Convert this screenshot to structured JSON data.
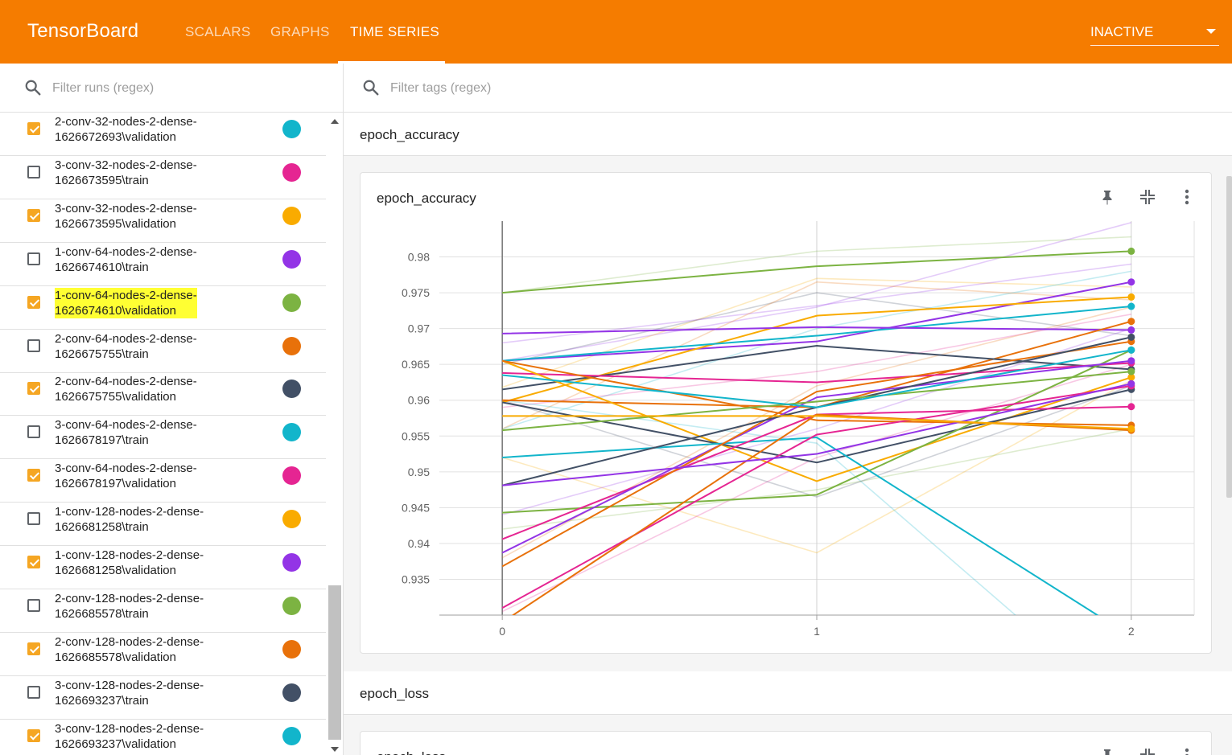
{
  "header": {
    "brand": "TensorBoard",
    "tabs": [
      {
        "label": "SCALARS",
        "active": false
      },
      {
        "label": "GRAPHS",
        "active": false
      },
      {
        "label": "TIME SERIES",
        "active": true
      }
    ],
    "run_state": "INACTIVE",
    "background_color": "#f57c00"
  },
  "sidebar": {
    "filter_placeholder": "Filter runs (regex)",
    "runs": [
      {
        "line1": "2-conv-32-nodes-2-dense-",
        "line2": "1626672693\\validation",
        "checked": true,
        "color": "#12b5cb",
        "highlighted": false
      },
      {
        "line1": "3-conv-32-nodes-2-dense-",
        "line2": "1626673595\\train",
        "checked": false,
        "color": "#e52592",
        "highlighted": false
      },
      {
        "line1": "3-conv-32-nodes-2-dense-",
        "line2": "1626673595\\validation",
        "checked": true,
        "color": "#f9ab00",
        "highlighted": false
      },
      {
        "line1": "1-conv-64-nodes-2-dense-",
        "line2": "1626674610\\train",
        "checked": false,
        "color": "#9334e6",
        "highlighted": false
      },
      {
        "line1": "1-conv-64-nodes-2-dense-",
        "line2": "1626674610\\validation",
        "checked": true,
        "color": "#7cb342",
        "highlighted": true
      },
      {
        "line1": "2-conv-64-nodes-2-dense-",
        "line2": "1626675755\\train",
        "checked": false,
        "color": "#e8710a",
        "highlighted": false
      },
      {
        "line1": "2-conv-64-nodes-2-dense-",
        "line2": "1626675755\\validation",
        "checked": true,
        "color": "#425066",
        "highlighted": false
      },
      {
        "line1": "3-conv-64-nodes-2-dense-",
        "line2": "1626678197\\train",
        "checked": false,
        "color": "#12b5cb",
        "highlighted": false
      },
      {
        "line1": "3-conv-64-nodes-2-dense-",
        "line2": "1626678197\\validation",
        "checked": true,
        "color": "#e52592",
        "highlighted": false
      },
      {
        "line1": "1-conv-128-nodes-2-dense-",
        "line2": "1626681258\\train",
        "checked": false,
        "color": "#f9ab00",
        "highlighted": false
      },
      {
        "line1": "1-conv-128-nodes-2-dense-",
        "line2": "1626681258\\validation",
        "checked": true,
        "color": "#9334e6",
        "highlighted": false
      },
      {
        "line1": "2-conv-128-nodes-2-dense-",
        "line2": "1626685578\\train",
        "checked": false,
        "color": "#7cb342",
        "highlighted": false
      },
      {
        "line1": "2-conv-128-nodes-2-dense-",
        "line2": "1626685578\\validation",
        "checked": true,
        "color": "#e8710a",
        "highlighted": false
      },
      {
        "line1": "3-conv-128-nodes-2-dense-",
        "line2": "1626693237\\train",
        "checked": false,
        "color": "#425066",
        "highlighted": false
      },
      {
        "line1": "3-conv-128-nodes-2-dense-",
        "line2": "1626693237\\validation",
        "checked": true,
        "color": "#12b5cb",
        "highlighted": false
      }
    ]
  },
  "main": {
    "tag_filter_placeholder": "Filter tags (regex)",
    "groups": [
      {
        "title": "epoch_accuracy",
        "card_title": "epoch_accuracy"
      },
      {
        "title": "epoch_loss",
        "card_title": "epoch_loss"
      }
    ]
  },
  "chart_data": {
    "type": "line",
    "title": "epoch_accuracy",
    "xlabel": "",
    "ylabel": "",
    "x": [
      0,
      1,
      2
    ],
    "xlim": [
      -0.2,
      2.2
    ],
    "ylim": [
      0.93,
      0.985
    ],
    "x_ticks": [
      "0",
      "1",
      "2"
    ],
    "y_ticks": [
      "0.935",
      "0.94",
      "0.945",
      "0.95",
      "0.955",
      "0.96",
      "0.965",
      "0.97",
      "0.975",
      "0.98"
    ],
    "grid": true,
    "series": [
      {
        "color": "#7cb342",
        "values": [
          0.975,
          0.9787,
          0.9808
        ]
      },
      {
        "color": "#9334e6",
        "values": [
          0.9655,
          0.9682,
          0.9765
        ]
      },
      {
        "color": "#f9ab00",
        "values": [
          0.9597,
          0.9718,
          0.9744
        ]
      },
      {
        "color": "#12b5cb",
        "values": [
          0.9655,
          0.969,
          0.9731
        ]
      },
      {
        "color": "#9334e6",
        "values": [
          0.9693,
          0.9702,
          0.9698
        ]
      },
      {
        "color": "#e8710a",
        "values": [
          0.96,
          0.959,
          0.971
        ]
      },
      {
        "color": "#425066",
        "values": [
          0.9615,
          0.9676,
          0.9643
        ]
      },
      {
        "color": "#e52592",
        "values": [
          0.9638,
          0.9625,
          0.9652
        ]
      },
      {
        "color": "#f9ab00",
        "values": [
          0.9655,
          0.9487,
          0.9632
        ]
      },
      {
        "color": "#425066",
        "values": [
          0.9597,
          0.9513,
          0.9615
        ]
      },
      {
        "color": "#7cb342",
        "values": [
          0.9443,
          0.9468,
          0.967
        ]
      },
      {
        "color": "#e8710a",
        "values": [
          0.9655,
          0.9572,
          0.9565
        ]
      },
      {
        "color": "#12b5cb",
        "values": [
          0.952,
          0.9548,
          0.927
        ]
      },
      {
        "color": "#e52592",
        "values": [
          0.9406,
          0.958,
          0.9591
        ]
      },
      {
        "color": "#9334e6",
        "values": [
          0.9387,
          0.9604,
          0.9655
        ]
      },
      {
        "color": "#e8710a",
        "values": [
          0.9368,
          0.9612,
          0.9682
        ]
      },
      {
        "color": "#e52592",
        "values": [
          0.931,
          0.9552,
          0.962
        ]
      },
      {
        "color": "#e8710a",
        "values": [
          0.929,
          0.958,
          0.9558
        ]
      },
      {
        "color": "#425066",
        "values": [
          0.9481,
          0.959,
          0.9688
        ]
      },
      {
        "color": "#9334e6",
        "values": [
          0.9481,
          0.9525,
          0.9623
        ]
      },
      {
        "color": "#7cb342",
        "values": [
          0.9558,
          0.9598,
          0.964
        ]
      },
      {
        "color": "#12b5cb",
        "values": [
          0.9635,
          0.959,
          0.967
        ]
      },
      {
        "color": "#f9ab00",
        "values": [
          0.9578,
          0.9578,
          0.956
        ]
      }
    ],
    "faint_series": [
      {
        "color": "#7cb342",
        "values": [
          0.975,
          0.9808,
          0.9828
        ]
      },
      {
        "color": "#9334e6",
        "values": [
          0.9655,
          0.973,
          0.9848
        ]
      },
      {
        "color": "#f9ab00",
        "values": [
          0.9618,
          0.977,
          0.9758
        ]
      },
      {
        "color": "#12b5cb",
        "values": [
          0.956,
          0.97,
          0.978
        ]
      },
      {
        "color": "#e52592",
        "values": [
          0.959,
          0.964,
          0.972
        ]
      },
      {
        "color": "#425066",
        "values": [
          0.965,
          0.975,
          0.969
        ]
      },
      {
        "color": "#9334e6",
        "values": [
          0.968,
          0.9732,
          0.979
        ]
      },
      {
        "color": "#f9ab00",
        "values": [
          0.952,
          0.9387,
          0.9628
        ]
      },
      {
        "color": "#e8710a",
        "values": [
          0.956,
          0.9765,
          0.974
        ]
      },
      {
        "color": "#12b5cb",
        "values": [
          0.96,
          0.954,
          0.916
        ]
      },
      {
        "color": "#7cb342",
        "values": [
          0.942,
          0.9475,
          0.956
        ]
      },
      {
        "color": "#e52592",
        "values": [
          0.9305,
          0.952,
          0.965
        ]
      },
      {
        "color": "#425066",
        "values": [
          0.96,
          0.9465,
          0.962
        ]
      },
      {
        "color": "#9334e6",
        "values": [
          0.944,
          0.956,
          0.97
        ]
      },
      {
        "color": "#e8710a",
        "values": [
          0.938,
          0.962,
          0.973
        ]
      }
    ]
  }
}
